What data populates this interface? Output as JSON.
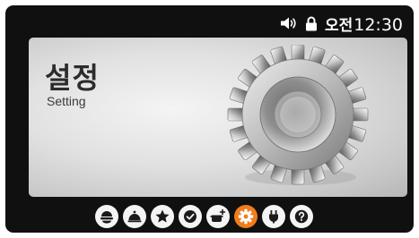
{
  "status_bar": {
    "icons": [
      "speaker-icon",
      "lock-icon"
    ],
    "ampm": "오전",
    "time": "12:30"
  },
  "panel": {
    "title": "설정",
    "subtitle": "Setting",
    "illustration": "gear"
  },
  "dock": {
    "items": [
      {
        "icon": "dome-icon",
        "active": false
      },
      {
        "icon": "cloche-icon",
        "active": false
      },
      {
        "icon": "star-icon",
        "active": false
      },
      {
        "icon": "check-icon",
        "active": false
      },
      {
        "icon": "pot-plus-icon",
        "active": false
      },
      {
        "icon": "gear-icon",
        "active": true
      },
      {
        "icon": "plug-icon",
        "active": false
      },
      {
        "icon": "question-icon",
        "active": false
      }
    ]
  },
  "colors": {
    "accent": "#f07d1a",
    "screen_background": "#101010",
    "dock_icon_background": "#f4f4f4",
    "dock_glyph": "#1a1a1a"
  }
}
